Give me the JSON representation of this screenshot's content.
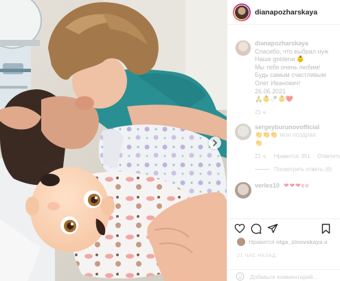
{
  "post": {
    "username": "dianapozharskaya",
    "photo_description": "Couple kissing in a hospital room with a newborn, baby face covered by a baby emoji",
    "sticker_icon": "baby-emoji-icon"
  },
  "caption": {
    "username": "dianapozharskaya",
    "lines": [
      "Спасибо, что выбрал нуж",
      "Наше goldenи 👶",
      "Мы тебя очень любим!",
      "Будь самым счастливым",
      "Олег Иванович!",
      "26.06.2021"
    ],
    "emoji_line": "🙏👶🍼👶❤️",
    "time": "21 ч."
  },
  "comments": [
    {
      "username": "sergeyburunovofficial",
      "text": "👏👏👏 мои поздрав",
      "text2": "👏",
      "time": "21 ч.",
      "likes": "Нравится: 351",
      "reply_label": "Ответить",
      "view_replies": "Посмотреть ответы (6)"
    },
    {
      "username": "verles10",
      "text": "❤❤❤ее"
    }
  ],
  "actions": {
    "like_icon": "heart-icon",
    "comment_icon": "comment-icon",
    "share_icon": "share-icon",
    "save_icon": "bookmark-icon"
  },
  "likes_text": {
    "prefix": "Нравится",
    "user": "olga_zinovskaya",
    "suffix": "и"
  },
  "date_label": "21 ЧАС НАЗАД",
  "add_comment_placeholder": "Добавьте комментарий..."
}
